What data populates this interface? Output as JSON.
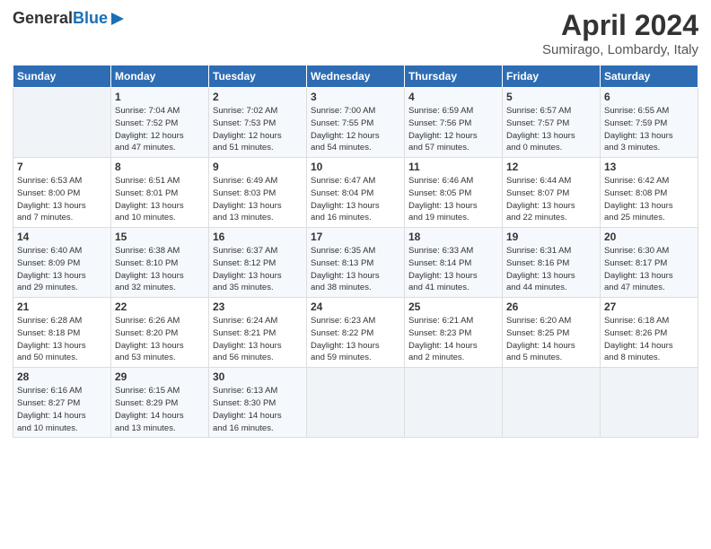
{
  "header": {
    "logo_line1": "General",
    "logo_line2": "Blue",
    "month": "April 2024",
    "location": "Sumirago, Lombardy, Italy"
  },
  "days_of_week": [
    "Sunday",
    "Monday",
    "Tuesday",
    "Wednesday",
    "Thursday",
    "Friday",
    "Saturday"
  ],
  "weeks": [
    [
      {
        "day": "",
        "info": ""
      },
      {
        "day": "1",
        "info": "Sunrise: 7:04 AM\nSunset: 7:52 PM\nDaylight: 12 hours\nand 47 minutes."
      },
      {
        "day": "2",
        "info": "Sunrise: 7:02 AM\nSunset: 7:53 PM\nDaylight: 12 hours\nand 51 minutes."
      },
      {
        "day": "3",
        "info": "Sunrise: 7:00 AM\nSunset: 7:55 PM\nDaylight: 12 hours\nand 54 minutes."
      },
      {
        "day": "4",
        "info": "Sunrise: 6:59 AM\nSunset: 7:56 PM\nDaylight: 12 hours\nand 57 minutes."
      },
      {
        "day": "5",
        "info": "Sunrise: 6:57 AM\nSunset: 7:57 PM\nDaylight: 13 hours\nand 0 minutes."
      },
      {
        "day": "6",
        "info": "Sunrise: 6:55 AM\nSunset: 7:59 PM\nDaylight: 13 hours\nand 3 minutes."
      }
    ],
    [
      {
        "day": "7",
        "info": "Sunrise: 6:53 AM\nSunset: 8:00 PM\nDaylight: 13 hours\nand 7 minutes."
      },
      {
        "day": "8",
        "info": "Sunrise: 6:51 AM\nSunset: 8:01 PM\nDaylight: 13 hours\nand 10 minutes."
      },
      {
        "day": "9",
        "info": "Sunrise: 6:49 AM\nSunset: 8:03 PM\nDaylight: 13 hours\nand 13 minutes."
      },
      {
        "day": "10",
        "info": "Sunrise: 6:47 AM\nSunset: 8:04 PM\nDaylight: 13 hours\nand 16 minutes."
      },
      {
        "day": "11",
        "info": "Sunrise: 6:46 AM\nSunset: 8:05 PM\nDaylight: 13 hours\nand 19 minutes."
      },
      {
        "day": "12",
        "info": "Sunrise: 6:44 AM\nSunset: 8:07 PM\nDaylight: 13 hours\nand 22 minutes."
      },
      {
        "day": "13",
        "info": "Sunrise: 6:42 AM\nSunset: 8:08 PM\nDaylight: 13 hours\nand 25 minutes."
      }
    ],
    [
      {
        "day": "14",
        "info": "Sunrise: 6:40 AM\nSunset: 8:09 PM\nDaylight: 13 hours\nand 29 minutes."
      },
      {
        "day": "15",
        "info": "Sunrise: 6:38 AM\nSunset: 8:10 PM\nDaylight: 13 hours\nand 32 minutes."
      },
      {
        "day": "16",
        "info": "Sunrise: 6:37 AM\nSunset: 8:12 PM\nDaylight: 13 hours\nand 35 minutes."
      },
      {
        "day": "17",
        "info": "Sunrise: 6:35 AM\nSunset: 8:13 PM\nDaylight: 13 hours\nand 38 minutes."
      },
      {
        "day": "18",
        "info": "Sunrise: 6:33 AM\nSunset: 8:14 PM\nDaylight: 13 hours\nand 41 minutes."
      },
      {
        "day": "19",
        "info": "Sunrise: 6:31 AM\nSunset: 8:16 PM\nDaylight: 13 hours\nand 44 minutes."
      },
      {
        "day": "20",
        "info": "Sunrise: 6:30 AM\nSunset: 8:17 PM\nDaylight: 13 hours\nand 47 minutes."
      }
    ],
    [
      {
        "day": "21",
        "info": "Sunrise: 6:28 AM\nSunset: 8:18 PM\nDaylight: 13 hours\nand 50 minutes."
      },
      {
        "day": "22",
        "info": "Sunrise: 6:26 AM\nSunset: 8:20 PM\nDaylight: 13 hours\nand 53 minutes."
      },
      {
        "day": "23",
        "info": "Sunrise: 6:24 AM\nSunset: 8:21 PM\nDaylight: 13 hours\nand 56 minutes."
      },
      {
        "day": "24",
        "info": "Sunrise: 6:23 AM\nSunset: 8:22 PM\nDaylight: 13 hours\nand 59 minutes."
      },
      {
        "day": "25",
        "info": "Sunrise: 6:21 AM\nSunset: 8:23 PM\nDaylight: 14 hours\nand 2 minutes."
      },
      {
        "day": "26",
        "info": "Sunrise: 6:20 AM\nSunset: 8:25 PM\nDaylight: 14 hours\nand 5 minutes."
      },
      {
        "day": "27",
        "info": "Sunrise: 6:18 AM\nSunset: 8:26 PM\nDaylight: 14 hours\nand 8 minutes."
      }
    ],
    [
      {
        "day": "28",
        "info": "Sunrise: 6:16 AM\nSunset: 8:27 PM\nDaylight: 14 hours\nand 10 minutes."
      },
      {
        "day": "29",
        "info": "Sunrise: 6:15 AM\nSunset: 8:29 PM\nDaylight: 14 hours\nand 13 minutes."
      },
      {
        "day": "30",
        "info": "Sunrise: 6:13 AM\nSunset: 8:30 PM\nDaylight: 14 hours\nand 16 minutes."
      },
      {
        "day": "",
        "info": ""
      },
      {
        "day": "",
        "info": ""
      },
      {
        "day": "",
        "info": ""
      },
      {
        "day": "",
        "info": ""
      }
    ]
  ]
}
